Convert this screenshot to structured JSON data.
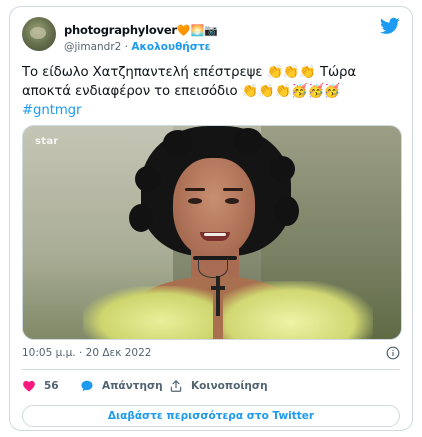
{
  "tweet": {
    "display_name": "photographylover",
    "name_emojis": "🧡🌅📷",
    "handle": "@jimandr2",
    "separator": " · ",
    "follow_label": "Ακολουθήστε",
    "text_main": "Το είδωλο Χατζηπαντελή επέστρεψε 👏👏👏 Τώρα αποκτά ενδιαφέρον το επεισόδιο 👏👏👏🥳🥳🥳",
    "hashtag": "#gntmgr",
    "media_watermark": "star",
    "timestamp": "10:05 μ.μ. · 20 Δεκ 2022"
  },
  "actions": {
    "likes_count": "56",
    "reply_label": "Απάντηση",
    "share_label": "Κοινοποίηση"
  },
  "footer": {
    "read_more_label": "Διαβάστε περισσότερα στο Twitter"
  },
  "colors": {
    "accent": "#1d9bf0",
    "like": "#f91880",
    "muted": "#536471",
    "border": "#cfd9de"
  },
  "icons": [
    "twitter-bird-icon",
    "info-icon",
    "heart-icon",
    "reply-bubble-icon",
    "share-icon"
  ]
}
